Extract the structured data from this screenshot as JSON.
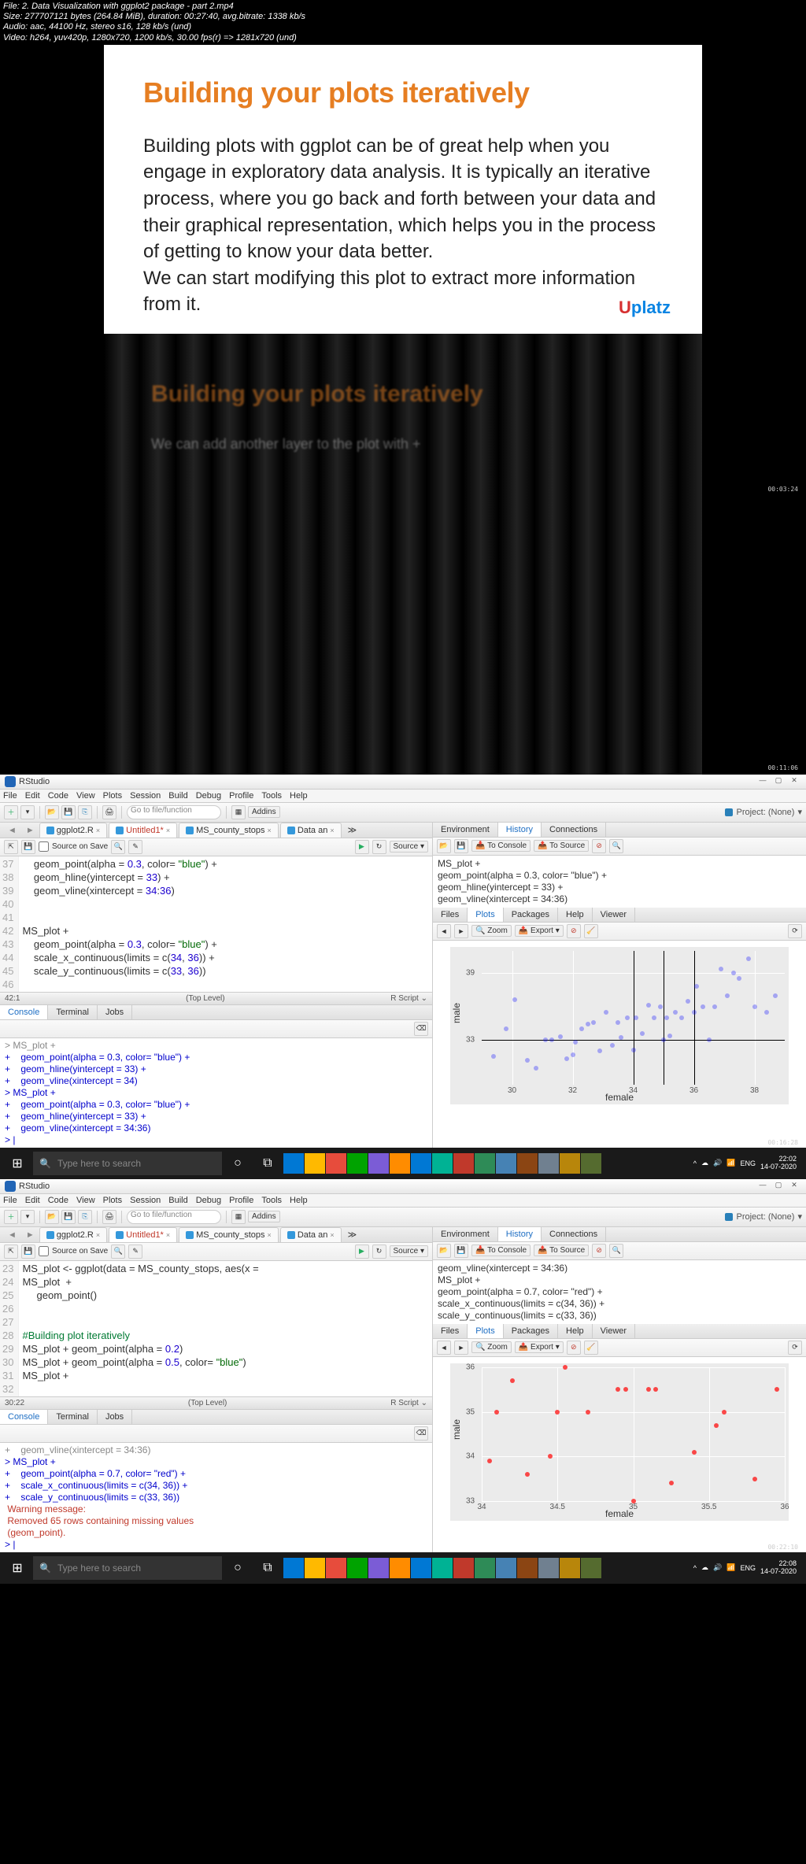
{
  "video_info": {
    "file": "File: 2. Data Visualization with ggplot2 package - part 2.mp4",
    "size": "Size: 277707121 bytes (264.84 MiB), duration: 00:27:40, avg.bitrate: 1338 kb/s",
    "audio": "Audio: aac, 44100 Hz, stereo s16, 128 kb/s (und)",
    "video": "Video: h264, yuv420p, 1280x720, 1200 kb/s, 30.00 fps(r) => 1281x720 (und)"
  },
  "slide": {
    "title": "Building your plots iteratively",
    "para1": "Building plots with ggplot can be of great help when you engage in exploratory data analysis. It is typically an iterative process, where you go back and forth between your data and their graphical representation, which helps you in the process of getting to know your data better.",
    "para2": "We can start modifying this plot to extract more information from it.",
    "logo_u": "U",
    "logo_platz": "platz",
    "ts": "00:03:24"
  },
  "curtain": {
    "title": "Building your plots iteratively",
    "sub": "We can add another layer to the plot with +",
    "ts": "00:11:06"
  },
  "rstudio1": {
    "app": "RStudio",
    "menu": [
      "File",
      "Edit",
      "Code",
      "View",
      "Plots",
      "Session",
      "Build",
      "Debug",
      "Profile",
      "Tools",
      "Help"
    ],
    "addins": "Addins",
    "goto": "Go to file/function",
    "project": "Project: (None)",
    "tabs": [
      {
        "name": "ggplot2.R",
        "active": false
      },
      {
        "name": "Untitled1*",
        "active": true,
        "dirty": true
      },
      {
        "name": "MS_county_stops",
        "active": false
      },
      {
        "name": "Data an",
        "active": false
      }
    ],
    "src_on_save": "Source on Save",
    "source_btn": "Source",
    "gutter": [
      "37",
      "38",
      "39",
      "40",
      "41",
      "42",
      "43",
      "44",
      "45",
      "46"
    ],
    "code": [
      "    geom_point(alpha = 0.3, color= \"blue\") +",
      "    geom_hline(yintercept = 33) +",
      "    geom_vline(xintercept = 34:36)",
      "",
      "",
      "MS_plot +",
      "    geom_point(alpha = 0.3, color= \"blue\") +",
      "    scale_x_continuous(limits = c(34, 36)) +",
      "    scale_y_continuous(limits = c(33, 36))",
      ""
    ],
    "status_left": "42:1",
    "status_mid": "(Top Level)",
    "status_right": "R Script",
    "cons_tabs": [
      "Console",
      "Terminal",
      "Jobs"
    ],
    "console": [
      {
        "p": "+",
        "t": "    geom_point(alpha = 0.3, color= \"blue\") +",
        "c": "blue"
      },
      {
        "p": "+",
        "t": "    geom_hline(yintercept = 33) +",
        "c": "blue"
      },
      {
        "p": "+",
        "t": "    geom_vline(xintercept = 34)",
        "c": "blue"
      },
      {
        "p": ">",
        "t": " MS_plot +",
        "c": "blue"
      },
      {
        "p": "+",
        "t": "    geom_point(alpha = 0.3, color= \"blue\") +",
        "c": "blue"
      },
      {
        "p": "+",
        "t": "    geom_hline(yintercept = 33) +",
        "c": "blue"
      },
      {
        "p": "+",
        "t": "    geom_vline(xintercept = 34:36)",
        "c": "blue"
      },
      {
        "p": ">",
        "t": " |",
        "c": "blue"
      }
    ],
    "env_tabs": [
      "Environment",
      "History",
      "Connections"
    ],
    "env_tools": {
      "to_console": "To Console",
      "to_source": "To Source"
    },
    "history": [
      "MS_plot +",
      "geom_point(alpha = 0.3, color= \"blue\") +",
      "geom_hline(yintercept = 33) +",
      "geom_vline(xintercept = 34:36)"
    ],
    "plot_tabs": [
      "Files",
      "Plots",
      "Packages",
      "Help",
      "Viewer"
    ],
    "plot_tools": {
      "zoom": "Zoom",
      "export": "Export"
    },
    "chart_data": {
      "type": "scatter",
      "xlabel": "female",
      "ylabel": "male",
      "xlim": [
        29,
        39
      ],
      "ylim": [
        29,
        41
      ],
      "xticks": [
        30,
        32,
        34,
        36,
        38
      ],
      "yticks": [
        33,
        39
      ],
      "hline": 33,
      "vlines": [
        34,
        35,
        36
      ],
      "point_style": {
        "color": "blue",
        "alpha": 0.3
      },
      "series": [
        {
          "name": "MS_plot",
          "values": [
            [
              29.4,
              31.5
            ],
            [
              29.8,
              34.0
            ],
            [
              30.1,
              36.6
            ],
            [
              30.5,
              31.2
            ],
            [
              30.8,
              30.5
            ],
            [
              31.1,
              33.0
            ],
            [
              31.3,
              33.0
            ],
            [
              31.6,
              33.3
            ],
            [
              31.8,
              31.3
            ],
            [
              32.0,
              31.7
            ],
            [
              32.1,
              32.8
            ],
            [
              32.3,
              34.0
            ],
            [
              32.5,
              34.4
            ],
            [
              32.7,
              34.6
            ],
            [
              32.9,
              32.0
            ],
            [
              33.1,
              35.5
            ],
            [
              33.3,
              32.5
            ],
            [
              33.5,
              34.6
            ],
            [
              33.6,
              33.2
            ],
            [
              33.8,
              35.0
            ],
            [
              34.0,
              32.1
            ],
            [
              34.1,
              35.0
            ],
            [
              34.3,
              33.6
            ],
            [
              34.5,
              36.1
            ],
            [
              34.7,
              35.0
            ],
            [
              34.9,
              36.0
            ],
            [
              35.0,
              33.0
            ],
            [
              35.1,
              35.0
            ],
            [
              35.2,
              33.4
            ],
            [
              35.4,
              35.5
            ],
            [
              35.6,
              35.0
            ],
            [
              35.8,
              36.5
            ],
            [
              36.0,
              35.5
            ],
            [
              36.1,
              37.8
            ],
            [
              36.3,
              36.0
            ],
            [
              36.5,
              33.0
            ],
            [
              36.7,
              36.0
            ],
            [
              36.9,
              39.4
            ],
            [
              37.1,
              37.0
            ],
            [
              37.3,
              39.0
            ],
            [
              37.5,
              38.5
            ],
            [
              37.8,
              40.3
            ],
            [
              38.0,
              36.0
            ],
            [
              38.4,
              35.5
            ],
            [
              38.7,
              37.0
            ]
          ]
        }
      ]
    },
    "taskbar": {
      "search": "Type here to search",
      "time": "22:02",
      "date": "14-07-2020",
      "lang": "ENG"
    },
    "ts": "00:16:28"
  },
  "rstudio2": {
    "app": "RStudio",
    "menu": [
      "File",
      "Edit",
      "Code",
      "View",
      "Plots",
      "Session",
      "Build",
      "Debug",
      "Profile",
      "Tools",
      "Help"
    ],
    "addins": "Addins",
    "goto": "Go to file/function",
    "project": "Project: (None)",
    "tabs": [
      {
        "name": "ggplot2.R",
        "active": false
      },
      {
        "name": "Untitled1*",
        "active": true,
        "dirty": true
      },
      {
        "name": "MS_county_stops",
        "active": false
      },
      {
        "name": "Data an",
        "active": false
      }
    ],
    "src_on_save": "Source on Save",
    "source_btn": "Source",
    "gutter": [
      "23",
      "24",
      "25",
      "26",
      "27",
      "28",
      "29",
      "30",
      "31",
      "32"
    ],
    "code": [
      "MS_plot <- ggplot(data = MS_county_stops, aes(x = ",
      "MS_plot  +",
      "     geom_point()",
      "",
      "",
      "#Building plot iteratively",
      "MS_plot + geom_point(alpha = 0.2)",
      "MS_plot + geom_point(alpha = 0.5, color= \"blue\")",
      "MS_plot + ",
      ""
    ],
    "status_left": "30:22",
    "status_mid": "(Top Level)",
    "status_right": "R Script",
    "cons_tabs": [
      "Console",
      "Terminal",
      "Jobs"
    ],
    "console": [
      {
        "p": "+",
        "t": "    geom_vline(xintercept = 34:36)",
        "c": "gray"
      },
      {
        "p": ">",
        "t": " MS_plot +",
        "c": "blue"
      },
      {
        "p": "+",
        "t": "    geom_point(alpha = 0.7, color= \"red\") +",
        "c": "blue"
      },
      {
        "p": "+",
        "t": "    scale_x_continuous(limits = c(34, 36)) +",
        "c": "blue"
      },
      {
        "p": "+",
        "t": "    scale_y_continuous(limits = c(33, 36))",
        "c": "blue"
      },
      {
        "p": "",
        "t": "Warning message:",
        "c": "red"
      },
      {
        "p": "",
        "t": "Removed 65 rows containing missing values",
        "c": "red"
      },
      {
        "p": "",
        "t": "(geom_point).",
        "c": "red"
      },
      {
        "p": ">",
        "t": " |",
        "c": "blue"
      }
    ],
    "env_tabs": [
      "Environment",
      "History",
      "Connections"
    ],
    "env_tools": {
      "to_console": "To Console",
      "to_source": "To Source"
    },
    "history": [
      "geom_vline(xintercept = 34:36)",
      "MS_plot +",
      "geom_point(alpha = 0.7, color= \"red\") +",
      "scale_x_continuous(limits = c(34, 36)) +",
      "scale_y_continuous(limits = c(33, 36))"
    ],
    "plot_tabs": [
      "Files",
      "Plots",
      "Packages",
      "Help",
      "Viewer"
    ],
    "plot_tools": {
      "zoom": "Zoom",
      "export": "Export"
    },
    "chart_data": {
      "type": "scatter",
      "xlabel": "female",
      "ylabel": "male",
      "xlim": [
        34,
        36
      ],
      "ylim": [
        33,
        36
      ],
      "xticks": [
        34.0,
        34.5,
        35.0,
        35.5,
        36.0
      ],
      "yticks": [
        33,
        34,
        35,
        36
      ],
      "point_style": {
        "color": "red",
        "alpha": 0.7
      },
      "series": [
        {
          "name": "MS_plot",
          "values": [
            [
              34.05,
              33.9
            ],
            [
              34.1,
              35.0
            ],
            [
              34.2,
              35.7
            ],
            [
              34.3,
              33.6
            ],
            [
              34.45,
              34.0
            ],
            [
              34.5,
              35.0
            ],
            [
              34.55,
              36.0
            ],
            [
              34.7,
              35.0
            ],
            [
              34.9,
              35.5
            ],
            [
              34.95,
              35.5
            ],
            [
              35.0,
              33.0
            ],
            [
              35.1,
              35.5
            ],
            [
              35.15,
              35.5
            ],
            [
              35.25,
              33.4
            ],
            [
              35.4,
              34.1
            ],
            [
              35.55,
              34.7
            ],
            [
              35.6,
              35.0
            ],
            [
              35.8,
              33.5
            ],
            [
              35.95,
              35.5
            ]
          ]
        }
      ]
    },
    "taskbar": {
      "search": "Type here to search",
      "time": "22:08",
      "date": "14-07-2020",
      "lang": "ENG"
    },
    "ts": "00:22:10"
  }
}
